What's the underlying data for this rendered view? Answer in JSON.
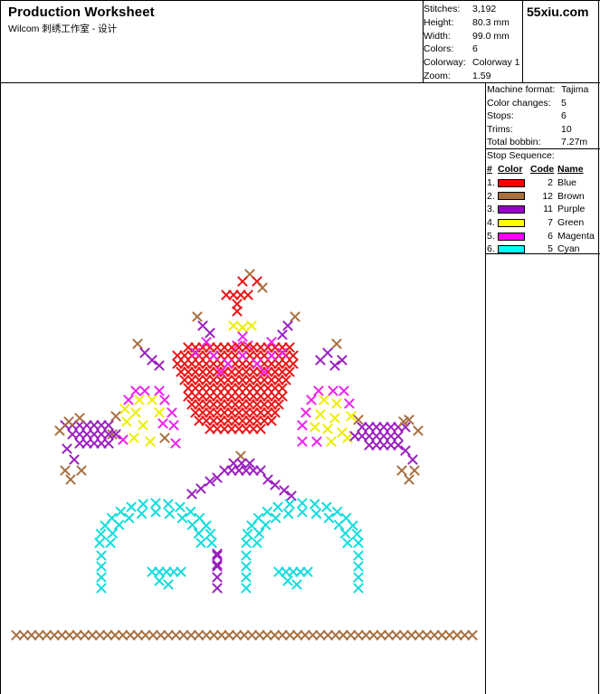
{
  "header": {
    "title": "Production Worksheet",
    "subtitle": "Wilcom 刺绣工作室 - 设计",
    "brand": "55xiu.com"
  },
  "stats": [
    {
      "label": "Stitches:",
      "value": "3,192"
    },
    {
      "label": "Height:",
      "value": "80.3 mm"
    },
    {
      "label": "Width:",
      "value": "99.0 mm"
    },
    {
      "label": "Colors:",
      "value": "6"
    },
    {
      "label": "Colorway:",
      "value": "Colorway 1"
    },
    {
      "label": "Zoom:",
      "value": "1.59"
    }
  ],
  "machine": [
    {
      "label": "Machine format:",
      "value": "Tajima"
    },
    {
      "label": "Color changes:",
      "value": "5"
    },
    {
      "label": "Stops:",
      "value": "6"
    },
    {
      "label": "Trims:",
      "value": "10"
    },
    {
      "label": "Total bobbin:",
      "value": "7.27m"
    }
  ],
  "stop_sequence": {
    "title": "Stop Sequence:",
    "headers": {
      "num": "#",
      "color": "Color",
      "code": "Code",
      "name": "Name"
    },
    "rows": [
      {
        "num": "1.",
        "color": "#ff0000",
        "code": "2",
        "name": "Blue"
      },
      {
        "num": "2.",
        "color": "#a8703c",
        "code": "12",
        "name": "Brown"
      },
      {
        "num": "3.",
        "color": "#9900c8",
        "code": "11",
        "name": "Purple"
      },
      {
        "num": "4.",
        "color": "#ffff00",
        "code": "7",
        "name": "Green"
      },
      {
        "num": "5.",
        "color": "#ff00ff",
        "code": "6",
        "name": "Magenta"
      },
      {
        "num": "6.",
        "color": "#00ffff",
        "code": "5",
        "name": "Cyan"
      }
    ]
  },
  "design_colors": {
    "red": "#ee1111",
    "brown": "#a87040",
    "purple": "#9a1fc0",
    "yellow": "#eeee00",
    "magenta": "#ee22ee",
    "cyan": "#11dddd"
  }
}
